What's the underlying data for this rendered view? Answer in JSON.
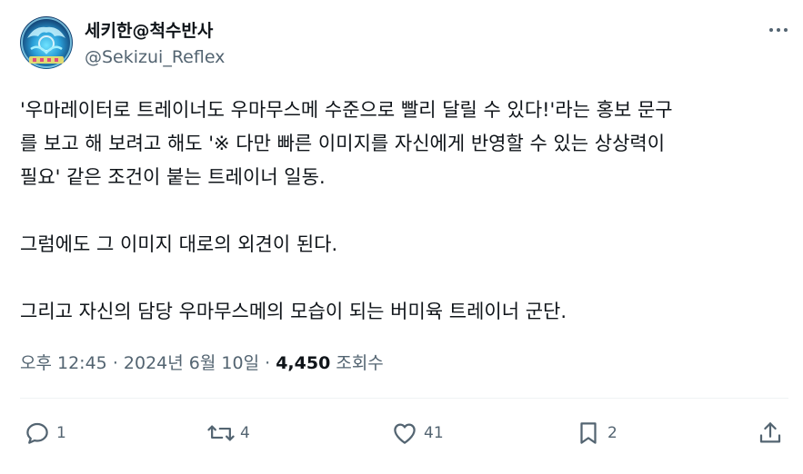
{
  "author": {
    "display_name": "세키한@척수반사",
    "handle": "@Sekizui_Reflex",
    "avatar_icon": "avatar-icon"
  },
  "tweet": {
    "lines": [
      "'우마레이터로 트레이너도 우마무스메 수준으로 빨리 달릴 수 있다!'라는 홍보 문구",
      "를 보고 해 보려고 해도 '※ 다만 빠른 이미지를 자신에게 반영할 수 있는 상상력이",
      "필요' 같은 조건이 붙는 트레이너 일동.",
      "그럼에도 그 이미지 대로의 외견이 된다.",
      "그리고 자신의 담당 우마무스메의 모습이 되는 버미육 트레이너 군단."
    ]
  },
  "meta": {
    "time": "오후 12:45",
    "separator": "·",
    "date": "2024년 6월 10일",
    "views_count": "4,450",
    "views_label": "조회수"
  },
  "actions": {
    "reply_count": "1",
    "retweet_count": "4",
    "like_count": "41",
    "bookmark_count": "2"
  },
  "colors": {
    "text": "#0f1419",
    "secondary": "#536471",
    "divider": "#eff3f4"
  }
}
